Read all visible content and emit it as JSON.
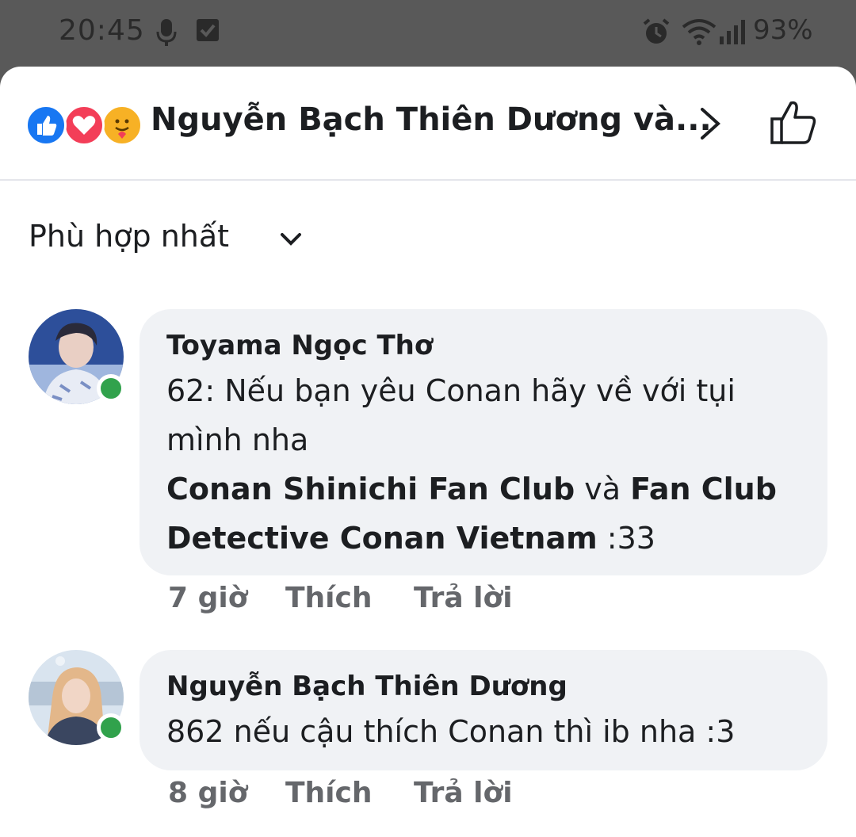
{
  "status_bar": {
    "time": "20:45",
    "battery": "93%"
  },
  "header": {
    "reactions": [
      "like-icon",
      "love-icon",
      "care-icon"
    ],
    "reactors_text": "Nguyễn Bạch Thiên Dương và..."
  },
  "sort": {
    "label": "Phù hợp nhất"
  },
  "comments": [
    {
      "author": "Toyama Ngọc Thơ",
      "text": "62: Nếu bạn yêu Conan hãy về với tụi mình nha",
      "mention_1": "Conan Shinichi Fan Club",
      "connector": " và ",
      "mention_2": "Fan Club Detective Conan Vietnam",
      "suffix": " :33",
      "time": "7 giờ",
      "like": "Thích",
      "reply": "Trả lời"
    },
    {
      "author": "Nguyễn Bạch Thiên Dương",
      "text": "862 nếu cậu thích Conan thì ib nha :3",
      "time": "8 giờ",
      "like": "Thích",
      "reply": "Trả lời"
    }
  ],
  "colors": {
    "online": "#31a24c",
    "bubble": "#f0f2f5",
    "like_blue": "#1877f2",
    "love_red": "#f33e58",
    "care_yellow": "#f7b125"
  }
}
